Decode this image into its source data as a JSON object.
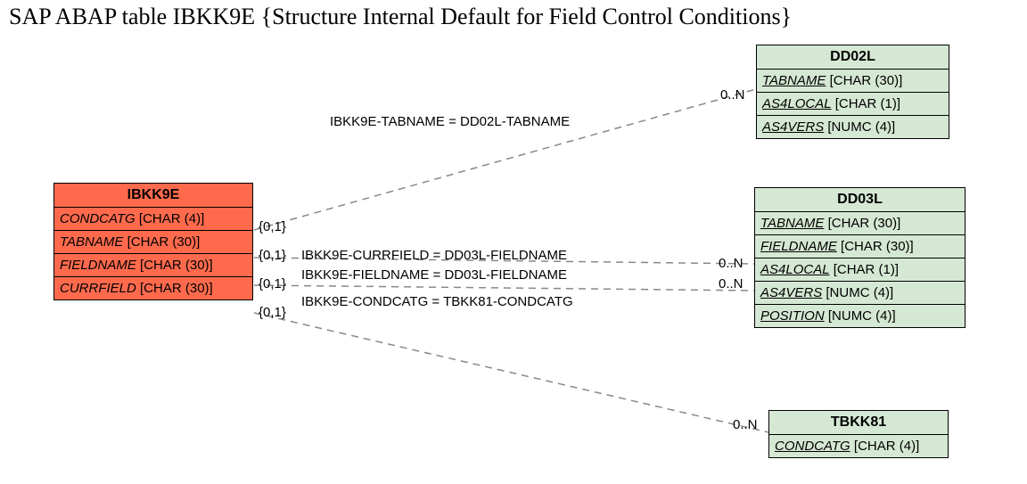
{
  "title": "SAP ABAP table IBKK9E {Structure Internal Default for Field Control Conditions}",
  "entities": {
    "ibkk9e": {
      "name": "IBKK9E",
      "fields": [
        {
          "name": "CONDCATG",
          "type": "[CHAR (4)]"
        },
        {
          "name": "TABNAME",
          "type": "[CHAR (30)]"
        },
        {
          "name": "FIELDNAME",
          "type": "[CHAR (30)]"
        },
        {
          "name": "CURRFIELD",
          "type": "[CHAR (30)]"
        }
      ]
    },
    "dd02l": {
      "name": "DD02L",
      "fields": [
        {
          "name": "TABNAME",
          "type": "[CHAR (30)]"
        },
        {
          "name": "AS4LOCAL",
          "type": "[CHAR (1)]"
        },
        {
          "name": "AS4VERS",
          "type": "[NUMC (4)]"
        }
      ]
    },
    "dd03l": {
      "name": "DD03L",
      "fields": [
        {
          "name": "TABNAME",
          "type": "[CHAR (30)]"
        },
        {
          "name": "FIELDNAME",
          "type": "[CHAR (30)]"
        },
        {
          "name": "AS4LOCAL",
          "type": "[CHAR (1)]"
        },
        {
          "name": "AS4VERS",
          "type": "[NUMC (4)]"
        },
        {
          "name": "POSITION",
          "type": "[NUMC (4)]"
        }
      ]
    },
    "tbkk81": {
      "name": "TBKK81",
      "fields": [
        {
          "name": "CONDCATG",
          "type": "[CHAR (4)]"
        }
      ]
    }
  },
  "relations": {
    "r1": {
      "label": "IBKK9E-TABNAME = DD02L-TABNAME",
      "card_left": "{0,1}",
      "card_right": "0..N"
    },
    "r2": {
      "label": "IBKK9E-CURRFIELD = DD03L-FIELDNAME",
      "card_left": "{0,1}",
      "card_right": "0..N"
    },
    "r3": {
      "label": "IBKK9E-FIELDNAME = DD03L-FIELDNAME",
      "card_left": "{0,1}",
      "card_right": "0..N"
    },
    "r4": {
      "label": "IBKK9E-CONDCATG = TBKK81-CONDCATG",
      "card_left": "{0,1}",
      "card_right": "0..N"
    }
  },
  "chart_data": {
    "type": "table",
    "description": "Entity-relationship diagram for SAP ABAP table IBKK9E",
    "entities": [
      {
        "name": "IBKK9E",
        "color": "orange",
        "fields": [
          "CONDCATG CHAR(4)",
          "TABNAME CHAR(30)",
          "FIELDNAME CHAR(30)",
          "CURRFIELD CHAR(30)"
        ]
      },
      {
        "name": "DD02L",
        "color": "green",
        "fields": [
          "TABNAME CHAR(30)",
          "AS4LOCAL CHAR(1)",
          "AS4VERS NUMC(4)"
        ]
      },
      {
        "name": "DD03L",
        "color": "green",
        "fields": [
          "TABNAME CHAR(30)",
          "FIELDNAME CHAR(30)",
          "AS4LOCAL CHAR(1)",
          "AS4VERS NUMC(4)",
          "POSITION NUMC(4)"
        ]
      },
      {
        "name": "TBKK81",
        "color": "green",
        "fields": [
          "CONDCATG CHAR(4)"
        ]
      }
    ],
    "relations": [
      {
        "from": "IBKK9E.TABNAME",
        "to": "DD02L.TABNAME",
        "card_from": "{0,1}",
        "card_to": "0..N"
      },
      {
        "from": "IBKK9E.CURRFIELD",
        "to": "DD03L.FIELDNAME",
        "card_from": "{0,1}",
        "card_to": "0..N"
      },
      {
        "from": "IBKK9E.FIELDNAME",
        "to": "DD03L.FIELDNAME",
        "card_from": "{0,1}",
        "card_to": "0..N"
      },
      {
        "from": "IBKK9E.CONDCATG",
        "to": "TBKK81.CONDCATG",
        "card_from": "{0,1}",
        "card_to": "0..N"
      }
    ]
  }
}
